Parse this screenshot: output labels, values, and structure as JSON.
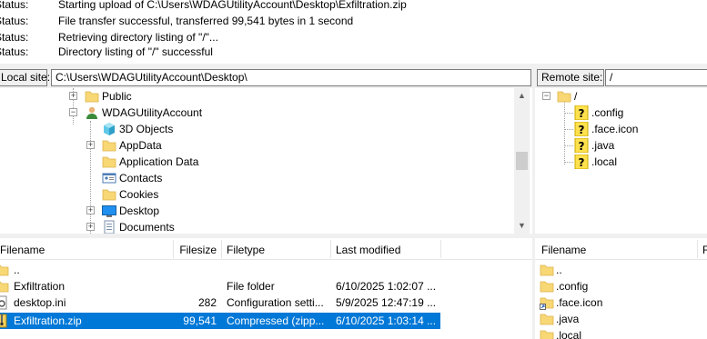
{
  "message_log": [
    {
      "status": "Status:",
      "message": "Starting upload of C:\\Users\\WDAGUtilityAccount\\Desktop\\Exfiltration.zip"
    },
    {
      "status": "Status:",
      "message": "File transfer successful, transferred 99,541 bytes in 1 second"
    },
    {
      "status": "Status:",
      "message": "Retrieving directory listing of \"/\"..."
    },
    {
      "status": "Status:",
      "message": "Directory listing of \"/\" successful"
    }
  ],
  "local": {
    "site_label": "Local site:",
    "path": "C:\\Users\\WDAGUtilityAccount\\Desktop\\",
    "tree": [
      {
        "label": "Public",
        "icon": "folder-icon"
      },
      {
        "label": "WDAGUtilityAccount",
        "icon": "user-icon"
      },
      {
        "label": "3D Objects",
        "icon": "3d-objects-icon"
      },
      {
        "label": "AppData",
        "icon": "folder-icon"
      },
      {
        "label": "Application Data",
        "icon": "folder-icon"
      },
      {
        "label": "Contacts",
        "icon": "contacts-icon"
      },
      {
        "label": "Cookies",
        "icon": "folder-icon"
      },
      {
        "label": "Desktop",
        "icon": "desktop-icon"
      },
      {
        "label": "Documents",
        "icon": "documents-icon"
      }
    ],
    "columns": {
      "filename": "Filename",
      "filesize": "Filesize",
      "filetype": "Filetype",
      "modified": "Last modified"
    },
    "files": [
      {
        "name": "..",
        "size": "",
        "type": "",
        "modified": "",
        "icon": "folder-icon"
      },
      {
        "name": "Exfiltration",
        "size": "",
        "type": "File folder",
        "modified": "6/10/2025 1:02:07 ...",
        "icon": "folder-icon"
      },
      {
        "name": "desktop.ini",
        "size": "282",
        "type": "Configuration setti...",
        "modified": "5/9/2025 12:47:19 ...",
        "icon": "settings-file-icon"
      },
      {
        "name": "Exfiltration.zip",
        "size": "99,541",
        "type": "Compressed (zipp...",
        "modified": "6/10/2025 1:03:14 ...",
        "icon": "zip-file-icon",
        "selected": true
      }
    ]
  },
  "remote": {
    "site_label": "Remote site:",
    "path": "/",
    "tree_root": "/",
    "tree": [
      {
        "label": ".config",
        "icon": "unknown-folder-icon"
      },
      {
        "label": ".face.icon",
        "icon": "unknown-folder-icon"
      },
      {
        "label": ".java",
        "icon": "unknown-folder-icon"
      },
      {
        "label": ".local",
        "icon": "unknown-folder-icon"
      }
    ],
    "columns": {
      "filename": "Filename",
      "filesize": "F"
    },
    "files": [
      {
        "name": "..",
        "icon": "folder-icon"
      },
      {
        "name": ".config",
        "icon": "folder-icon"
      },
      {
        "name": ".face.icon",
        "icon": "folder-shortcut-icon"
      },
      {
        "name": ".java",
        "icon": "folder-icon"
      },
      {
        "name": ".local",
        "icon": "folder-icon"
      }
    ]
  }
}
